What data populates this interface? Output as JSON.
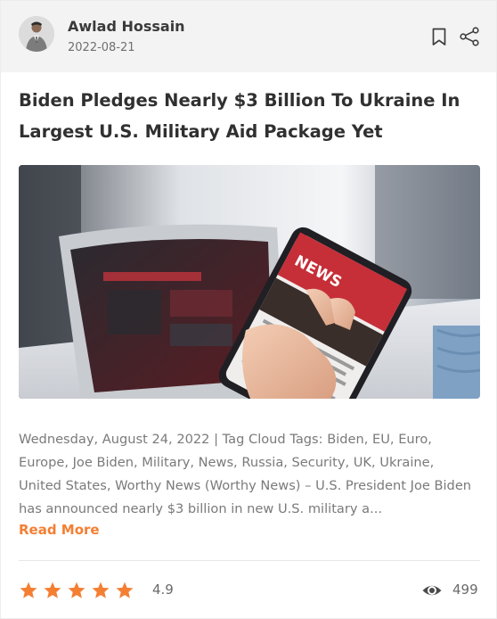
{
  "author": {
    "name": "Awlad Hossain",
    "date": "2022-08-21"
  },
  "actions": {
    "bookmark_icon": "bookmark-icon",
    "share_icon": "share-icon"
  },
  "article": {
    "title": "Biden Pledges Nearly $3 Billion To Ukraine In Largest U.S. Military Aid Package Yet",
    "image_sign_text": "NEWS",
    "excerpt": "Wednesday, August 24, 2022 | Tag Cloud Tags: Biden, EU, Euro, Europe, Joe Biden, Military, News, Russia, Security, UK, Ukraine, United States, Worthy News (Worthy News) – U.S. President Joe Biden has announced nearly $3 billion in new U.S. military a...",
    "read_more": "Read More"
  },
  "footer": {
    "rating": "4.9",
    "stars": 5,
    "views": "499"
  },
  "colors": {
    "accent": "#f47f33",
    "header_bg": "#f3f3f3"
  }
}
